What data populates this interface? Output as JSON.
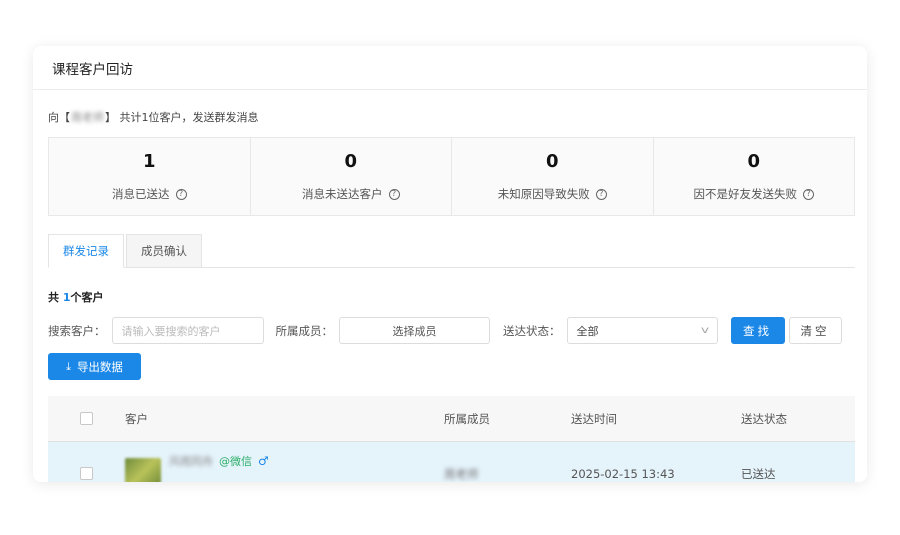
{
  "header": {
    "title": "课程客户回访"
  },
  "summary": {
    "prefix": "向【",
    "blurred_name": "周老师",
    "suffix": "】 共计1位客户，发送群发消息"
  },
  "stats": [
    {
      "value": "1",
      "label": "消息已送达"
    },
    {
      "value": "0",
      "label": "消息未送达客户"
    },
    {
      "value": "0",
      "label": "未知原因导致失败"
    },
    {
      "value": "0",
      "label": "因不是好友发送失败"
    }
  ],
  "tabs": [
    {
      "label": "群发记录",
      "active": true
    },
    {
      "label": "成员确认",
      "active": false
    }
  ],
  "total": {
    "prefix": "共 ",
    "count": "1",
    "suffix": "个客户"
  },
  "filters": {
    "search_label": "搜索客户：",
    "search_placeholder": "请输入要搜索的客户",
    "member_label": "所属成员：",
    "member_button": "选择成员",
    "status_label": "送达状态：",
    "status_value": "全部",
    "find_button": "查找",
    "clear_button": "清空"
  },
  "export_button": "导出数据",
  "table": {
    "columns": [
      "客户",
      "所属成员",
      "送达时间",
      "送达状态"
    ],
    "rows": [
      {
        "customer_name": "风雨同舟",
        "wechat_tag": "@微信",
        "gender_icon": "♂",
        "member": "周老师",
        "time": "2025-02-15 13:43",
        "status": "已送达"
      }
    ]
  },
  "colors": {
    "accent": "#1b88e8",
    "wechat": "#2aae67",
    "row_highlight": "#e5f3fb"
  }
}
